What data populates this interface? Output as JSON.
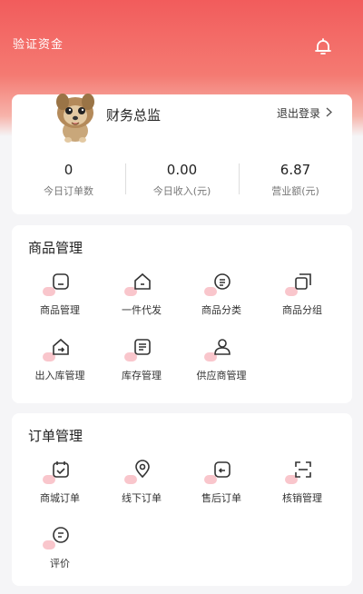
{
  "app": {
    "title": "验证资金"
  },
  "profile": {
    "name": "财务总监",
    "logout_label": "退出登录"
  },
  "stats": [
    {
      "value": "0",
      "label": "今日订单数"
    },
    {
      "value": "0.00",
      "label": "今日收入(元)"
    },
    {
      "value": "6.87",
      "label": "营业额(元)"
    }
  ],
  "goods": {
    "title": "商品管理",
    "items": [
      {
        "label": "商品管理",
        "icon": "product-icon"
      },
      {
        "label": "一件代发",
        "icon": "dropship-icon"
      },
      {
        "label": "商品分类",
        "icon": "category-icon"
      },
      {
        "label": "商品分组",
        "icon": "group-icon"
      },
      {
        "label": "出入库管理",
        "icon": "stock-io-icon"
      },
      {
        "label": "库存管理",
        "icon": "inventory-icon"
      },
      {
        "label": "供应商管理",
        "icon": "supplier-icon"
      }
    ]
  },
  "orders": {
    "title": "订单管理",
    "items": [
      {
        "label": "商城订单",
        "icon": "mall-order-icon"
      },
      {
        "label": "线下订单",
        "icon": "offline-order-icon"
      },
      {
        "label": "售后订单",
        "icon": "after-sale-icon"
      },
      {
        "label": "核销管理",
        "icon": "verify-icon"
      },
      {
        "label": "评价",
        "icon": "review-icon"
      }
    ]
  },
  "colors": {
    "accent": "#f25c5c",
    "icon_dot": "#f8c0c6"
  }
}
